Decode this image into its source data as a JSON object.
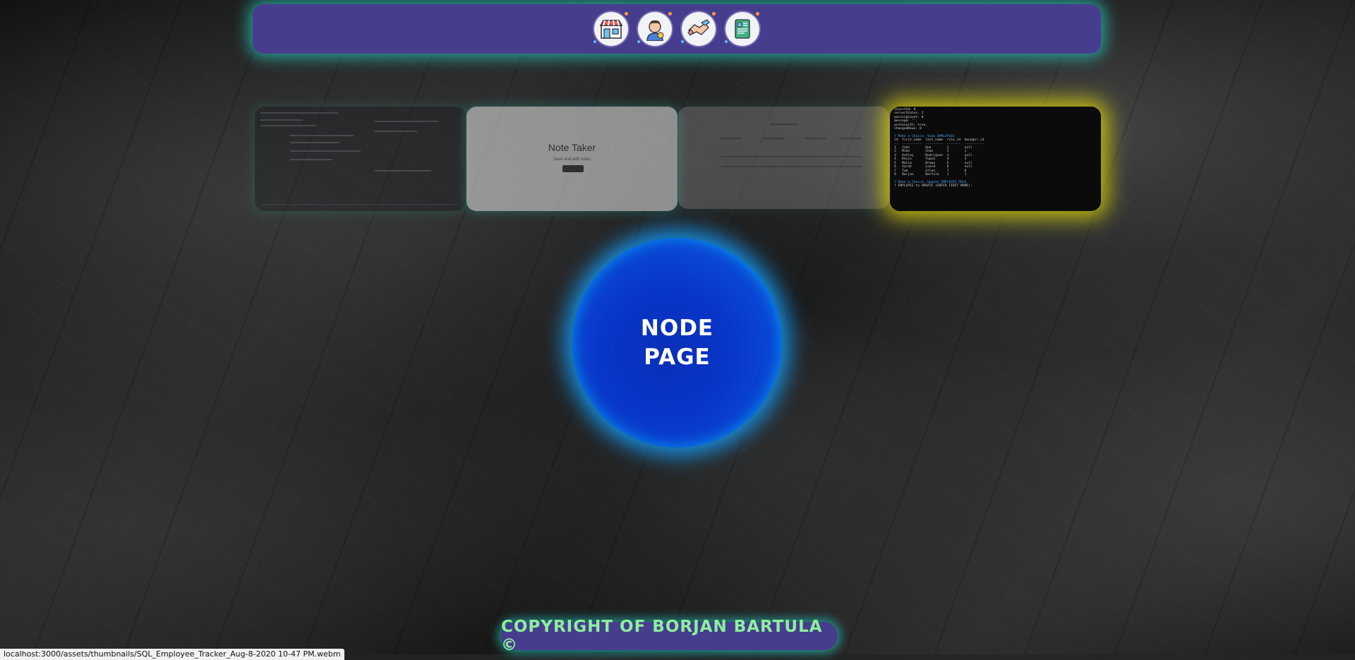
{
  "navbar": {
    "icons": [
      {
        "name": "storefront-icon"
      },
      {
        "name": "profile-icon"
      },
      {
        "name": "handshake-icon"
      },
      {
        "name": "resume-icon"
      }
    ]
  },
  "projects": {
    "note_taker": {
      "title": "Note Taker",
      "subtitle": "Save and edit notes"
    }
  },
  "node_page": {
    "line1": "NODE",
    "line2": "PAGE"
  },
  "footer": {
    "text": "COPYRIGHT OF BORJAN BARTULA ©"
  },
  "status_bar": {
    "url": "localhost:3000/assets/thumbnails/SQL_Employee_Tracker_Aug-8-2020 10-47 PM.webm"
  },
  "colors": {
    "navbar_bg": "#473d8f",
    "teal_glow": "#24c8be",
    "footer_text": "#8cf09a",
    "highlight_glow": "#d7d20a",
    "node_blue": "#0836c8"
  }
}
